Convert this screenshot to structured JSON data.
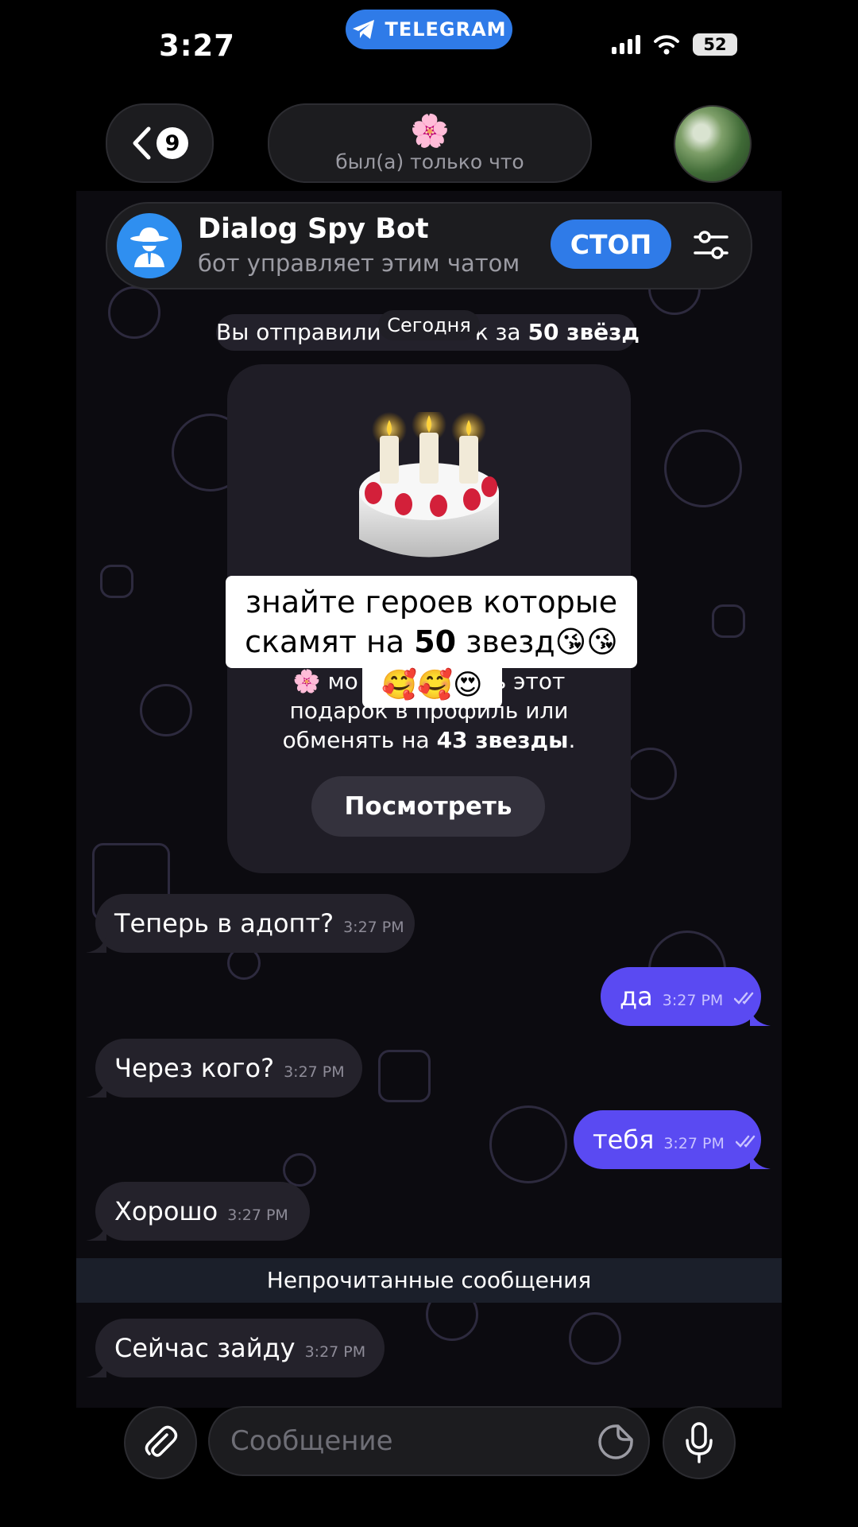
{
  "status_bar": {
    "time": "3:27",
    "app_pill": "TELEGRAM",
    "battery": "52"
  },
  "header": {
    "back_count": "9",
    "title_emoji": "🌸",
    "status": "был(а) только что"
  },
  "bot_banner": {
    "name": "Dialog Spy Bot",
    "subtitle": "бот управляет этим чатом",
    "stop_label": "СТОП"
  },
  "gift": {
    "service_line_parts": [
      "Вы отправили",
      "к за",
      "50 звёзд"
    ],
    "date_chip": "Сегодня",
    "description_line1_parts": [
      "🌸 мо",
      "ь этот"
    ],
    "description_line2": "подарок в профиль или",
    "description_line3_prefix": "обменять на",
    "description_line3_bold": "43 звезды",
    "description_line3_suffix": ".",
    "view_button": "Посмотреть"
  },
  "overlay": {
    "line1": "знайте героев которые",
    "line2_prefix": "скамят на",
    "line2_bold": "50",
    "line2_suffix": "звезд😘😘",
    "line3": "🥰🥰😍"
  },
  "messages": [
    {
      "text": "Теперь в адопт?",
      "time": "3:27 PM",
      "side": "in"
    },
    {
      "text": "да",
      "time": "3:27 PM",
      "side": "out"
    },
    {
      "text": "Через кого?",
      "time": "3:27 PM",
      "side": "in"
    },
    {
      "text": "тебя",
      "time": "3:27 PM",
      "side": "out"
    },
    {
      "text": "Хорошо",
      "time": "3:27 PM",
      "side": "in"
    },
    {
      "text": "Сейчас зайду",
      "time": "3:27 PM",
      "side": "in"
    }
  ],
  "unread_divider": "Непрочитанные сообщения",
  "composer": {
    "placeholder": "Сообщение"
  },
  "colors": {
    "accent": "#2f7be8",
    "outgoing_bubble": "#5a4af2",
    "incoming_bubble": "#24222b"
  },
  "icons": [
    "telegram-icon",
    "signal-icon",
    "wifi-icon",
    "battery-icon",
    "back-chevron-icon",
    "bot-spy-icon",
    "filter-settings-icon",
    "cake-icon",
    "double-check-icon",
    "paperclip-icon",
    "sticker-icon",
    "microphone-icon"
  ]
}
